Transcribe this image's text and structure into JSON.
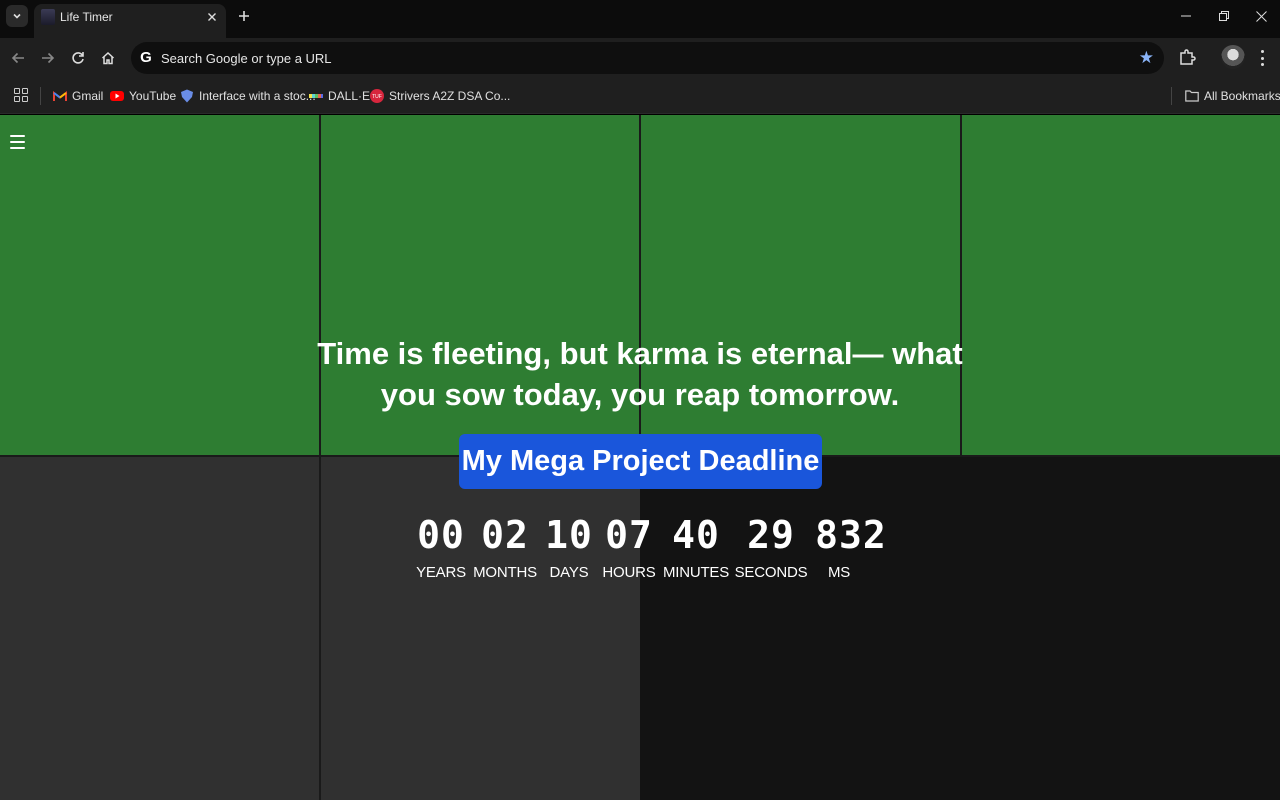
{
  "browser": {
    "tab_title": "Life Timer",
    "omnibox_placeholder": "Search Google or type a URL",
    "bookmarks": [
      {
        "label": "Gmail",
        "icon": "gmail-icon"
      },
      {
        "label": "YouTube",
        "icon": "youtube-icon"
      },
      {
        "label": "Interface with a stoc...",
        "icon": "shield-icon"
      },
      {
        "label": "DALL·E",
        "icon": "dalle-icon"
      },
      {
        "label": "Strivers A2Z DSA Co...",
        "icon": "tuf-icon"
      }
    ],
    "all_bookmarks_label": "All Bookmarks"
  },
  "page": {
    "quote": "Time is fleeting, but karma is eternal— what you sow today, you reap tomorrow.",
    "deadline_button": "My Mega Project Deadline",
    "countdown": [
      {
        "value": "00",
        "label": "YEARS"
      },
      {
        "value": "02",
        "label": "MONTHS"
      },
      {
        "value": "10",
        "label": "DAYS"
      },
      {
        "value": "07",
        "label": "HOURS"
      },
      {
        "value": "40",
        "label": "MINUTES"
      },
      {
        "value": "29",
        "label": "SECONDS"
      },
      {
        "value": "832",
        "label": "MS"
      }
    ]
  },
  "colors": {
    "green_tile": "#2e7d32",
    "grey_tile": "#303030",
    "dark_tile": "#131313",
    "button_blue": "#1a56db"
  }
}
